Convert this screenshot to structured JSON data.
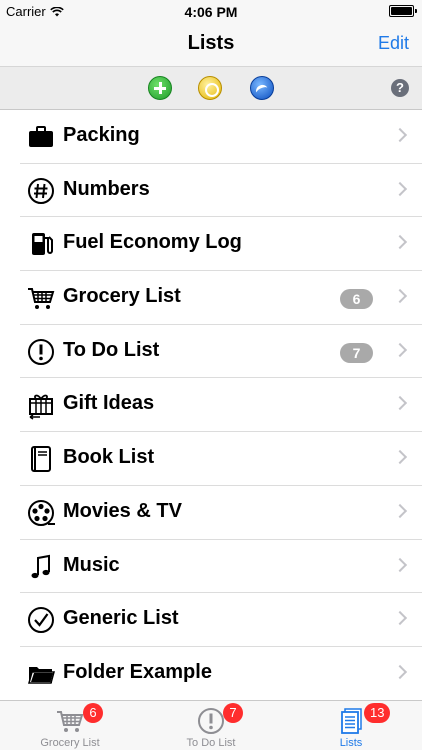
{
  "status": {
    "carrier": "Carrier",
    "time": "4:06 PM"
  },
  "nav": {
    "title": "Lists",
    "edit_label": "Edit"
  },
  "toolbar": {
    "help_label": "?"
  },
  "lists": [
    {
      "label": "Packing",
      "icon": "briefcase-icon",
      "badge": ""
    },
    {
      "label": "Numbers",
      "icon": "hash-icon",
      "badge": ""
    },
    {
      "label": "Fuel Economy Log",
      "icon": "fuel-pump-icon",
      "badge": ""
    },
    {
      "label": "Grocery List",
      "icon": "cart-icon",
      "badge": "6"
    },
    {
      "label": "To Do List",
      "icon": "exclamation-icon",
      "badge": "7"
    },
    {
      "label": "Gift Ideas",
      "icon": "gift-icon",
      "badge": ""
    },
    {
      "label": "Book List",
      "icon": "book-icon",
      "badge": ""
    },
    {
      "label": "Movies & TV",
      "icon": "film-reel-icon",
      "badge": ""
    },
    {
      "label": "Music",
      "icon": "music-note-icon",
      "badge": ""
    },
    {
      "label": "Generic List",
      "icon": "checkmark-icon",
      "badge": ""
    },
    {
      "label": "Folder Example",
      "icon": "folder-icon",
      "badge": ""
    }
  ],
  "tabs": [
    {
      "label": "Grocery List",
      "icon": "cart-icon",
      "badge": "6"
    },
    {
      "label": "To Do List",
      "icon": "exclamation-icon",
      "badge": "7"
    },
    {
      "label": "Lists",
      "icon": "lists-icon",
      "badge": "13"
    }
  ],
  "colors": {
    "accent": "#1f7ae8",
    "badge_gray": "#a9a9a9",
    "badge_red": "#ff2d2d"
  }
}
